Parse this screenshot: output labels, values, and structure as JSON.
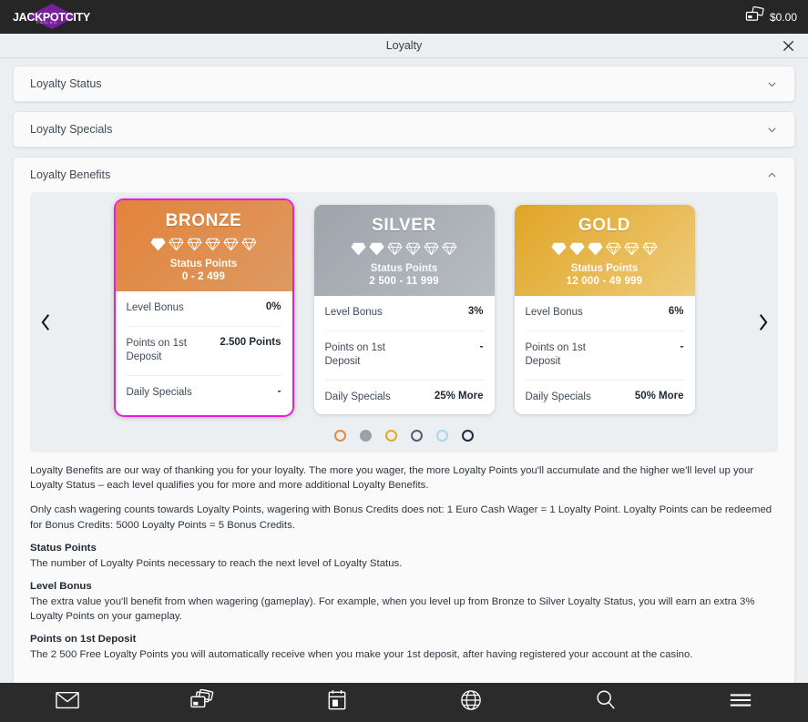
{
  "topbar": {
    "logo_text": "JACKPOTCITY",
    "logo_sub": "CASINO",
    "balance": "$0.00",
    "balance_icon": "cards-icon"
  },
  "titlebar": {
    "title": "Loyalty",
    "close_icon": "close-icon"
  },
  "accordions": [
    {
      "label": "Loyalty Status",
      "expanded": false,
      "icon": "chevron-down-icon"
    },
    {
      "label": "Loyalty Specials",
      "expanded": false,
      "icon": "chevron-down-icon"
    },
    {
      "label": "Loyalty Benefits",
      "expanded": true,
      "icon": "chevron-up-icon"
    }
  ],
  "carousel": {
    "prev_icon": "chevron-left-icon",
    "next_icon": "chevron-right-icon",
    "active_index": 0,
    "dots": [
      {
        "name": "dot-bronze",
        "color": "#e08c3c",
        "filled": false
      },
      {
        "name": "dot-silver",
        "color": "#9aa1a9",
        "filled": true
      },
      {
        "name": "dot-gold",
        "color": "#e3a92b",
        "filled": false
      },
      {
        "name": "dot-platinum",
        "color": "#5a5a72",
        "filled": false
      },
      {
        "name": "dot-diamond",
        "color": "#a9d6e8",
        "filled": false
      },
      {
        "name": "dot-privilege",
        "color": "#1d2a44",
        "filled": false
      }
    ],
    "cards": [
      {
        "name": "BRONZE",
        "gems_total": 6,
        "gems_filled": 1,
        "status_points_label": "Status Points",
        "status_points_range": "0 - 2 499",
        "header_color_from": "#e2833a",
        "header_color_to": "#dd9a63",
        "highlighted": true,
        "rows": [
          {
            "label": "Level Bonus",
            "value": "0%"
          },
          {
            "label": "Points on 1st Deposit",
            "value": "2.500 Points"
          },
          {
            "label": "Daily Specials",
            "value": "-"
          }
        ]
      },
      {
        "name": "SILVER",
        "gems_total": 6,
        "gems_filled": 2,
        "status_points_label": "Status Points",
        "status_points_range": "2 500 - 11 999",
        "header_color_from": "#9ea4ab",
        "header_color_to": "#b6bcc2",
        "highlighted": false,
        "rows": [
          {
            "label": "Level Bonus",
            "value": "3%"
          },
          {
            "label": "Points on 1st Deposit",
            "value": "-"
          },
          {
            "label": "Daily Specials",
            "value": "25% More"
          }
        ]
      },
      {
        "name": "GOLD",
        "gems_total": 6,
        "gems_filled": 3,
        "status_points_label": "Status Points",
        "status_points_range": "12 000 - 49 999",
        "header_color_from": "#e0a525",
        "header_color_to": "#eecb7a",
        "highlighted": false,
        "rows": [
          {
            "label": "Level Bonus",
            "value": "6%"
          },
          {
            "label": "Points on 1st Deposit",
            "value": "-"
          },
          {
            "label": "Daily Specials",
            "value": "50% More"
          }
        ]
      }
    ]
  },
  "body_text": {
    "para1": "Loyalty Benefits are our way of thanking you for your loyalty. The more you wager, the more Loyalty Points you'll accumulate and the higher we'll level up your Loyalty Status – each level qualifies you for more and more additional Loyalty Benefits.",
    "para2": "Only cash wagering counts towards Loyalty Points, wagering with Bonus Credits does not: 1 Euro Cash Wager = 1 Loyalty Point. Loyalty Points can be redeemed for Bonus Credits: 5000 Loyalty Points = 5 Bonus Credits.",
    "sections": [
      {
        "heading": "Status Points",
        "text": "The number of Loyalty Points necessary to reach the next level of Loyalty Status."
      },
      {
        "heading": "Level Bonus",
        "text": "The extra value you'll benefit from when wagering (gameplay). For example, when you level up from Bronze to Silver Loyalty Status, you will earn an extra 3% Loyalty Points on your gameplay."
      },
      {
        "heading": "Points on 1st Deposit",
        "text": "The 2 500 Free Loyalty Points you will automatically receive when you make your 1st deposit, after having registered your account at the casino."
      }
    ]
  },
  "bottomnav": [
    {
      "name": "nav-mail",
      "icon": "envelope-icon"
    },
    {
      "name": "nav-banking",
      "icon": "cards-icon"
    },
    {
      "name": "nav-promotions",
      "icon": "calendar-icon"
    },
    {
      "name": "nav-games",
      "icon": "globe-icon"
    },
    {
      "name": "nav-search",
      "icon": "search-icon"
    },
    {
      "name": "nav-menu",
      "icon": "hamburger-icon"
    }
  ]
}
